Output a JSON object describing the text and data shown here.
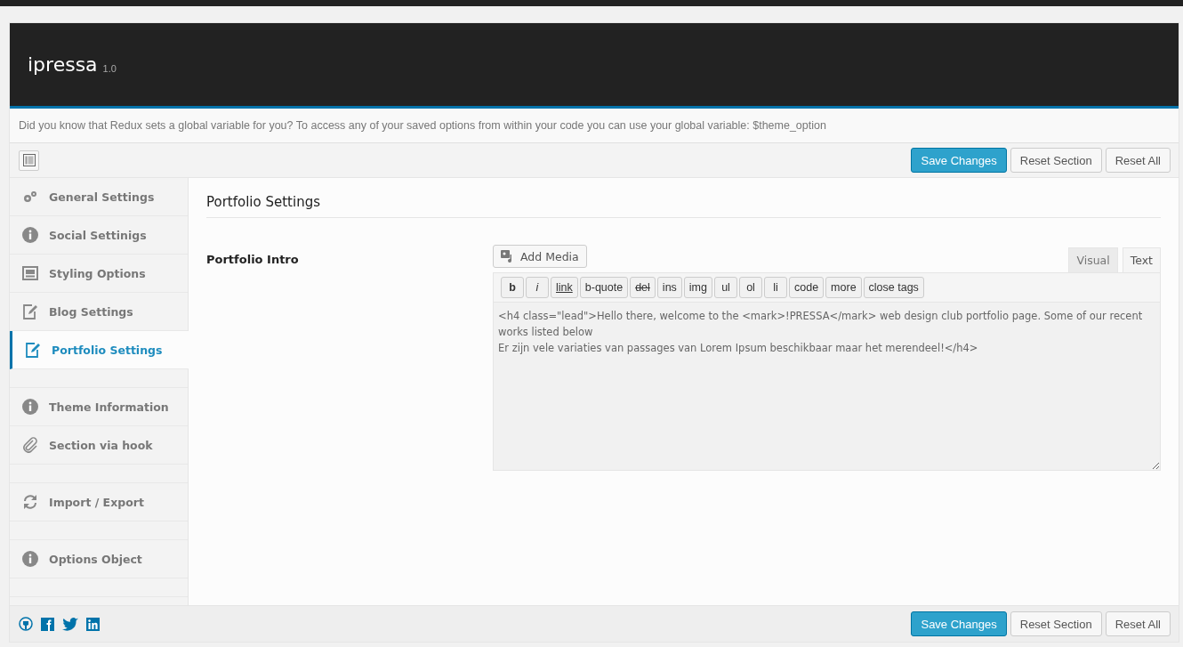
{
  "header": {
    "title": "ipressa",
    "version": "1.0"
  },
  "notice": "Did you know that Redux sets a global variable for you? To access any of your saved options from within your code you can use your global variable: $theme_option",
  "action_buttons": [
    {
      "label": "Save Changes",
      "kind": "primary"
    },
    {
      "label": "Reset Section",
      "kind": "secondary"
    },
    {
      "label": "Reset All",
      "kind": "secondary"
    }
  ],
  "sidebar": {
    "items": [
      {
        "kind": "link",
        "label": "General Settings",
        "selected": false
      },
      {
        "kind": "link",
        "label": "Social Settinigs",
        "selected": false
      },
      {
        "kind": "link",
        "label": "Styling Options",
        "selected": false
      },
      {
        "kind": "link",
        "label": "Blog Settings",
        "selected": false
      },
      {
        "kind": "link",
        "label": "Portfolio Settings",
        "selected": true
      },
      {
        "kind": "spacer"
      },
      {
        "kind": "link",
        "label": "Theme Information",
        "selected": false
      },
      {
        "kind": "link",
        "label": "Section via hook",
        "selected": false
      },
      {
        "kind": "spacer"
      },
      {
        "kind": "link",
        "label": "Import / Export",
        "selected": false
      },
      {
        "kind": "spacer"
      },
      {
        "kind": "link",
        "label": "Options Object",
        "selected": false
      },
      {
        "kind": "spacer"
      }
    ]
  },
  "section": {
    "title": "Portfolio Settings",
    "field_label": "Portfolio Intro",
    "add_media": "Add Media",
    "editor_tabs": [
      {
        "label": "Visual",
        "selected": false
      },
      {
        "label": "Text",
        "selected": true
      }
    ],
    "quicktags": [
      {
        "label": "b",
        "kind": "bold"
      },
      {
        "label": "i",
        "kind": "italic"
      },
      {
        "label": "link",
        "kind": "underline"
      },
      {
        "label": "b-quote",
        "kind": "plain"
      },
      {
        "label": "del",
        "kind": "strike"
      },
      {
        "label": "ins",
        "kind": "plain"
      },
      {
        "label": "img",
        "kind": "plain"
      },
      {
        "label": "ul",
        "kind": "plain"
      },
      {
        "label": "ol",
        "kind": "plain"
      },
      {
        "label": "li",
        "kind": "plain"
      },
      {
        "label": "code",
        "kind": "plain"
      },
      {
        "label": "more",
        "kind": "plain"
      },
      {
        "label": "close tags",
        "kind": "plain"
      }
    ],
    "content": "<h4 class=\"lead\">Hello there, welcome to the <mark>!PRESSA</mark> web design club portfolio page. Some of our recent works listed below\nEr zijn vele variaties van passages van Lorem Ipsum beschikbaar maar het merendeel!</h4>"
  },
  "footer": {
    "buttons": [
      {
        "label": "Save Changes",
        "kind": "primary"
      },
      {
        "label": "Reset Section",
        "kind": "secondary"
      },
      {
        "label": "Reset All",
        "kind": "secondary"
      }
    ]
  }
}
